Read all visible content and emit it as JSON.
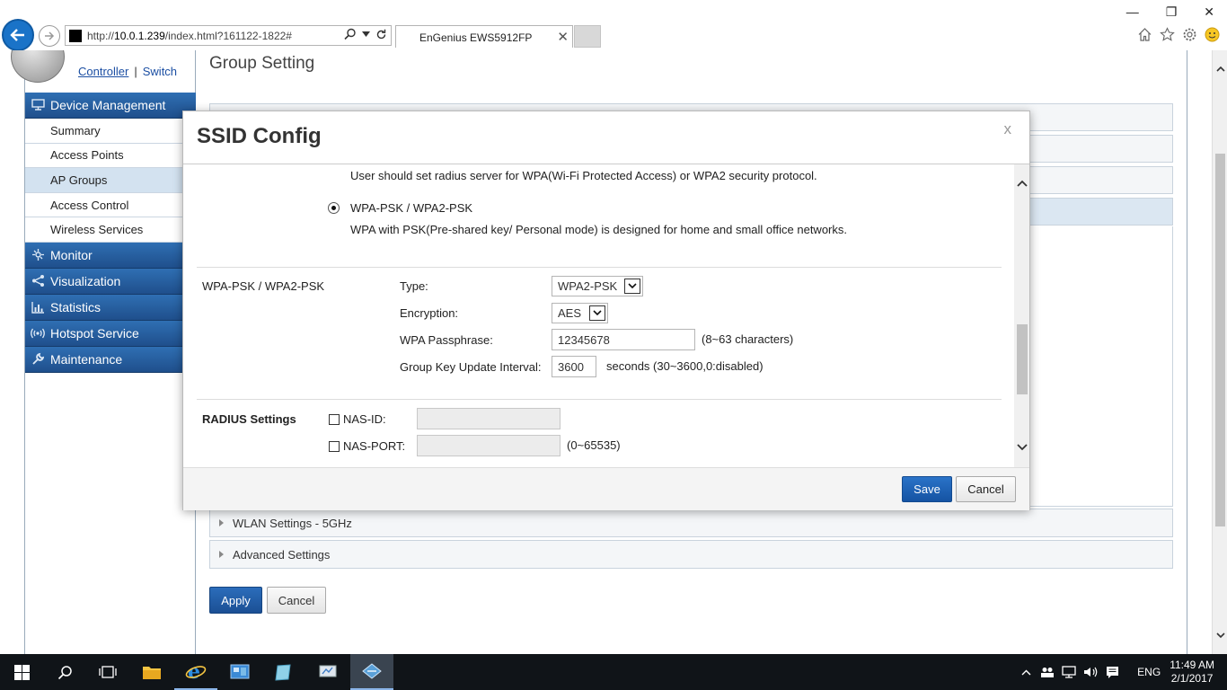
{
  "browser": {
    "url_prefix": "http://",
    "url_host": "10.0.1.239",
    "url_path": "/index.html?161122-1822#",
    "tab_title": "EnGenius EWS5912FP"
  },
  "topnav": {
    "controller": "Controller",
    "separator": "|",
    "switch": "Switch"
  },
  "sidebar": {
    "device_management": "Device Management",
    "device_items": [
      "Summary",
      "Access Points",
      "AP Groups",
      "Access Control",
      "Wireless Services"
    ],
    "monitor": "Monitor",
    "visualization": "Visualization",
    "statistics": "Statistics",
    "hotspot": "Hotspot Service",
    "maintenance": "Maintenance"
  },
  "page": {
    "title": "Group Setting",
    "wlan_5ghz": "WLAN Settings - 5GHz",
    "advanced": "Advanced Settings",
    "apply": "Apply",
    "cancel": "Cancel"
  },
  "modal": {
    "title": "SSID Config",
    "close": "x",
    "wpa_desc": "User should set radius server for WPA(Wi-Fi Protected Access) or WPA2 security protocol.",
    "psk_option": "WPA-PSK / WPA2-PSK",
    "psk_desc": "WPA with PSK(Pre-shared key/ Personal mode) is designed for home and small office networks.",
    "section_label": "WPA-PSK / WPA2-PSK",
    "type_label": "Type:",
    "type_value": "WPA2-PSK",
    "encryption_label": "Encryption:",
    "encryption_value": "AES",
    "passphrase_label": "WPA Passphrase:",
    "passphrase_value": "12345678",
    "passphrase_hint": "(8~63 characters)",
    "gkui_label": "Group Key Update Interval:",
    "gkui_value": "3600",
    "gkui_hint": "seconds (30~3600,0:disabled)",
    "radius_label": "RADIUS Settings",
    "nas_id_label": "NAS-ID:",
    "nas_port_label": "NAS-PORT:",
    "nas_port_hint": "(0~65535)",
    "save": "Save",
    "cancel": "Cancel"
  },
  "taskbar": {
    "lang": "ENG",
    "time": "11:49 AM",
    "date": "2/1/2017"
  },
  "colors": {
    "accent": "#1f4f8c",
    "save": "#1553a3"
  }
}
